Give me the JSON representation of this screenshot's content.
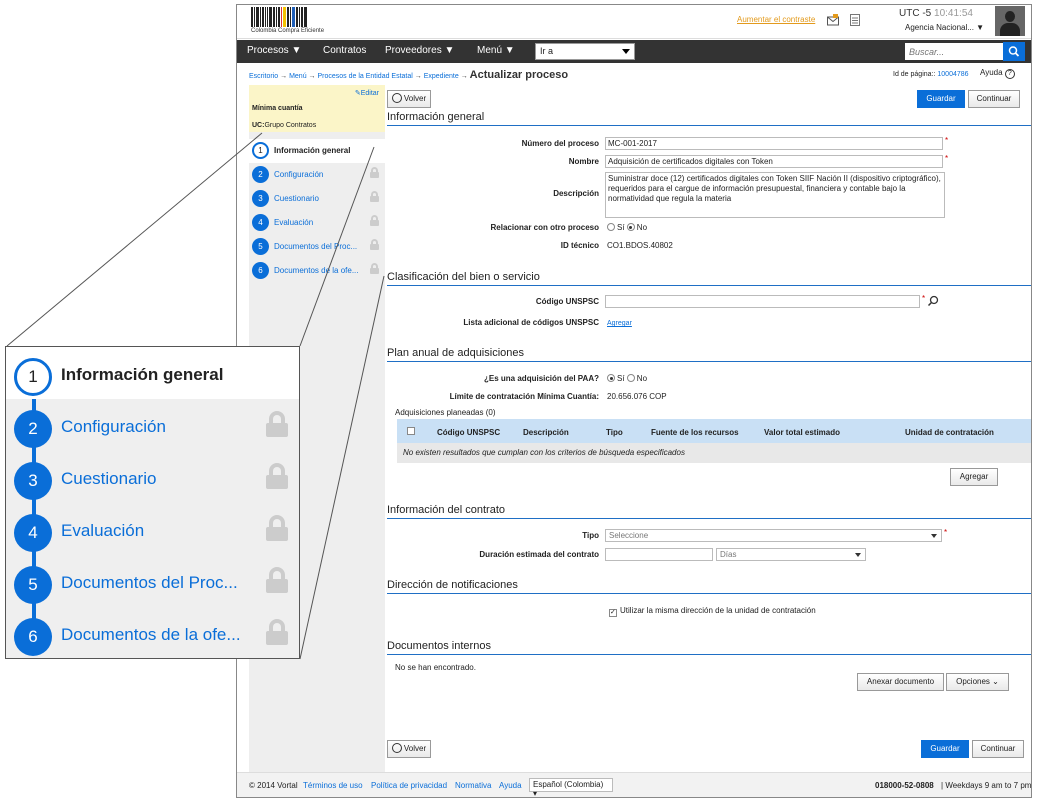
{
  "header": {
    "logo_text": "Colombia Compra Eficiente",
    "contrast_link": "Aumentar el contraste",
    "utc_label": "UTC -5",
    "time": "10:41:54",
    "agency": "Agencia Nacional..."
  },
  "nav": {
    "items": [
      "Procesos",
      "Contratos",
      "Proveedores",
      "Menú"
    ],
    "goto_value": "Ir a",
    "search_placeholder": "Buscar..."
  },
  "breadcrumb": {
    "items": [
      "Escritorio",
      "Menú",
      "Procesos de la Entidad Estatal",
      "Expediente"
    ],
    "current": "Actualizar proceso",
    "page_id_label": "Id de página::",
    "page_id": "10004786",
    "help": "Ayuda"
  },
  "sidebar": {
    "edit": "Editar",
    "modality": "Mínima cuantía",
    "uc_label": "UC:",
    "uc_value": "Grupo Contratos",
    "steps": [
      {
        "num": "1",
        "label": "Información general"
      },
      {
        "num": "2",
        "label": "Configuración"
      },
      {
        "num": "3",
        "label": "Cuestionario"
      },
      {
        "num": "4",
        "label": "Evaluación"
      },
      {
        "num": "5",
        "label": "Documentos del Proc..."
      },
      {
        "num": "6",
        "label": "Documentos de la ofe..."
      }
    ]
  },
  "buttons": {
    "back": "Volver",
    "save": "Guardar",
    "continue": "Continuar",
    "add": "Agregar",
    "attach": "Anexar documento",
    "options": "Opciones"
  },
  "general": {
    "title": "Información general",
    "process_number_label": "Número del proceso",
    "process_number": "MC-001-2017",
    "name_label": "Nombre",
    "name": "Adquisición de certificados digitales con Token",
    "description_label": "Descripción",
    "description": "Suministrar doce (12) certificados digitales con Token SIIF Nación II (dispositivo criptográfico), requeridos para el cargue de información presupuestal, financiera y contable bajo la normatividad que regula la materia",
    "relate_label": "Relacionar con otro proceso",
    "yes": "Sí",
    "no": "No",
    "tech_id_label": "ID técnico",
    "tech_id": "CO1.BDOS.40802"
  },
  "classification": {
    "title": "Clasificación del bien o servicio",
    "unspsc_label": "Código UNSPSC",
    "extra_label": "Lista adicional de códigos UNSPSC",
    "add_link": "Agregar"
  },
  "paa": {
    "title": "Plan anual de adquisiciones",
    "question_label": "¿Es una adquisición del PAA?",
    "limit_label": "Límite de contratación Mínima Cuantía:",
    "limit_value": "20.656.076 COP",
    "planned_label": "Adquisiciones planeadas (0)",
    "columns": [
      "Código UNSPSC",
      "Descripción",
      "Tipo",
      "Fuente de los recursos",
      "Valor total estimado",
      "Unidad de contratación"
    ],
    "empty": "No existen resultados que cumplan con los criterios de búsqueda especificados"
  },
  "contract": {
    "title": "Información del contrato",
    "type_label": "Tipo",
    "type_value": "Seleccione",
    "duration_label": "Duración estimada del contrato",
    "unit_value": "Días"
  },
  "notifications": {
    "title": "Dirección de notificaciones",
    "same_address": "Utilizar la misma dirección de la unidad de contratación"
  },
  "docs": {
    "title": "Documentos internos",
    "none": "No se han encontrado."
  },
  "footer": {
    "copyright": "© 2014 Vortal",
    "links": [
      "Términos de uso",
      "Política de privacidad",
      "Normativa",
      "Ayuda"
    ],
    "language": "Español (Colombia)",
    "phone": "018000-52-0808",
    "hours": "Weekdays 9 am to 7 pm"
  },
  "colors": {
    "accent": "#0a6ed8",
    "nav": "#333333",
    "highlight": "#fbf5c8"
  }
}
